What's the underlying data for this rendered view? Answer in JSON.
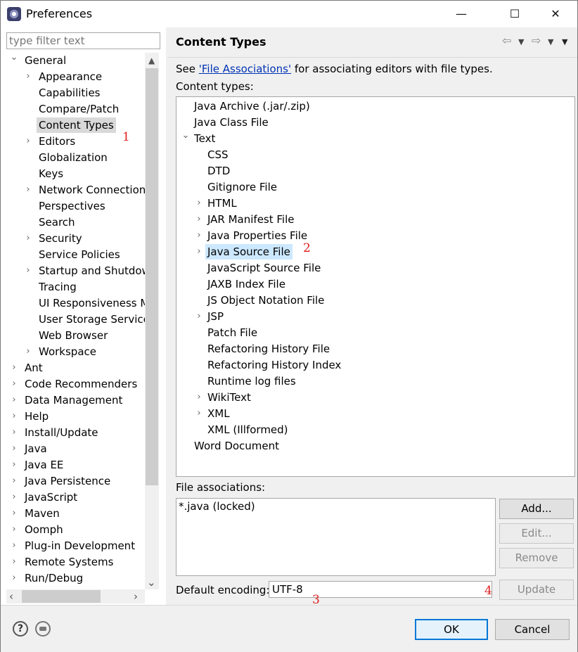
{
  "window": {
    "title": "Preferences",
    "minimize": "—",
    "maximize": "☐",
    "close": "✕"
  },
  "filter": {
    "placeholder": "type filter text"
  },
  "left_tree": {
    "general": "General",
    "general_children": [
      {
        "label": "Appearance",
        "expandable": true
      },
      {
        "label": "Capabilities",
        "expandable": false
      },
      {
        "label": "Compare/Patch",
        "expandable": false
      },
      {
        "label": "Content Types",
        "expandable": false,
        "selected": true
      },
      {
        "label": "Editors",
        "expandable": true
      },
      {
        "label": "Globalization",
        "expandable": false
      },
      {
        "label": "Keys",
        "expandable": false
      },
      {
        "label": "Network Connections",
        "expandable": true
      },
      {
        "label": "Perspectives",
        "expandable": false
      },
      {
        "label": "Search",
        "expandable": false
      },
      {
        "label": "Security",
        "expandable": true
      },
      {
        "label": "Service Policies",
        "expandable": false
      },
      {
        "label": "Startup and Shutdown",
        "expandable": true
      },
      {
        "label": "Tracing",
        "expandable": false
      },
      {
        "label": "UI Responsiveness Monitoring",
        "expandable": false
      },
      {
        "label": "User Storage Service",
        "expandable": false
      },
      {
        "label": "Web Browser",
        "expandable": false
      },
      {
        "label": "Workspace",
        "expandable": true
      }
    ],
    "top_level": [
      "Ant",
      "Code Recommenders",
      "Data Management",
      "Help",
      "Install/Update",
      "Java",
      "Java EE",
      "Java Persistence",
      "JavaScript",
      "Maven",
      "Oomph",
      "Plug-in Development",
      "Remote Systems",
      "Run/Debug"
    ]
  },
  "main": {
    "title": "Content Types",
    "intro_prefix": "See ",
    "intro_link": "'File Associations'",
    "intro_suffix": " for associating editors with file types.",
    "content_types_label": "Content types:",
    "content_types": {
      "root_items_top": [
        "Java Archive (.jar/.zip)",
        "Java Class File"
      ],
      "text_node": "Text",
      "text_children": [
        {
          "label": "CSS",
          "expandable": false
        },
        {
          "label": "DTD",
          "expandable": false
        },
        {
          "label": "Gitignore File",
          "expandable": false
        },
        {
          "label": "HTML",
          "expandable": true
        },
        {
          "label": "JAR Manifest File",
          "expandable": true
        },
        {
          "label": "Java Properties File",
          "expandable": true
        },
        {
          "label": "Java Source File",
          "expandable": true,
          "selected": true
        },
        {
          "label": "JavaScript Source File",
          "expandable": false
        },
        {
          "label": "JAXB Index File",
          "expandable": false
        },
        {
          "label": "JS Object Notation File",
          "expandable": false
        },
        {
          "label": "JSP",
          "expandable": true
        },
        {
          "label": "Patch File",
          "expandable": false
        },
        {
          "label": "Refactoring History File",
          "expandable": false
        },
        {
          "label": "Refactoring History Index",
          "expandable": false
        },
        {
          "label": "Runtime log files",
          "expandable": false
        },
        {
          "label": "WikiText",
          "expandable": true
        },
        {
          "label": "XML",
          "expandable": true
        },
        {
          "label": "XML (Illformed)",
          "expandable": false
        }
      ],
      "root_items_bottom": [
        "Word Document"
      ]
    },
    "file_assoc_label": "File associations:",
    "file_assoc_items": [
      "*.java (locked)"
    ],
    "buttons": {
      "add": "Add...",
      "edit": "Edit...",
      "remove": "Remove",
      "update": "Update"
    },
    "encoding_label": "Default encoding:",
    "encoding_value": "UTF-8"
  },
  "annotations": [
    "1",
    "2",
    "3",
    "4"
  ],
  "footer": {
    "ok": "OK",
    "cancel": "Cancel",
    "help_glyph": "?"
  },
  "colors": {
    "selection_left": "#d9d9d9",
    "selection_right": "#cce8ff",
    "link": "#0033b3",
    "annotation": "#e02020"
  }
}
